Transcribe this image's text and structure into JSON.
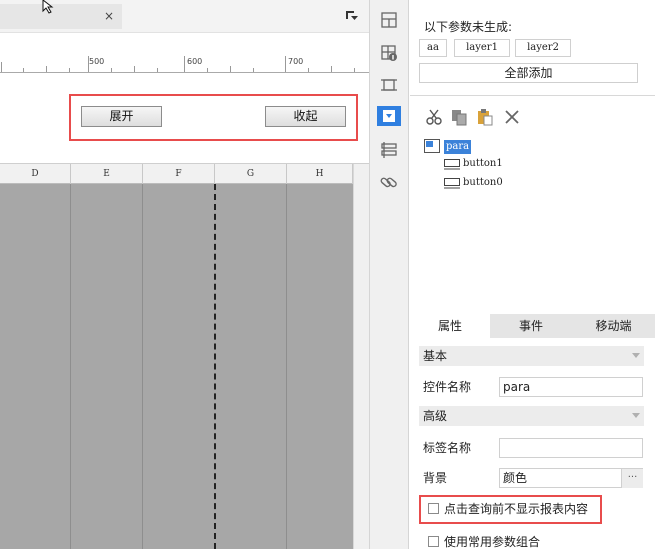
{
  "designer": {
    "tab_close": "×",
    "ruler_labels": [
      "500",
      "600",
      "700"
    ],
    "buttons": {
      "expand": "展开",
      "collapse": "收起"
    },
    "columns": [
      "D",
      "E",
      "F",
      "G",
      "H"
    ]
  },
  "toolbar_icons": [
    "layout-grid-icon",
    "widget-settings-icon",
    "frame-icon",
    "dropdown-widget-icon",
    "form-list-icon",
    "link-icon"
  ],
  "right_panel": {
    "uncreated_title": "以下参数未生成:",
    "param_tags": [
      "aa",
      "layer1",
      "layer2"
    ],
    "add_all": "全部添加",
    "tree": {
      "root": "para",
      "children": [
        "button1",
        "button0"
      ]
    },
    "tabs": [
      "属性",
      "事件",
      "移动端"
    ],
    "sections": {
      "basic": "基本",
      "advanced": "高级"
    },
    "fields": {
      "control_name_label": "控件名称",
      "control_name_value": "para",
      "tag_name_label": "标签名称",
      "tag_name_value": "",
      "background_label": "背景",
      "background_value": "颜色",
      "background_more": "···"
    },
    "checkboxes": {
      "hide_before_query": "点击查询前不显示报表内容",
      "use_common_params": "使用常用参数组合"
    }
  }
}
